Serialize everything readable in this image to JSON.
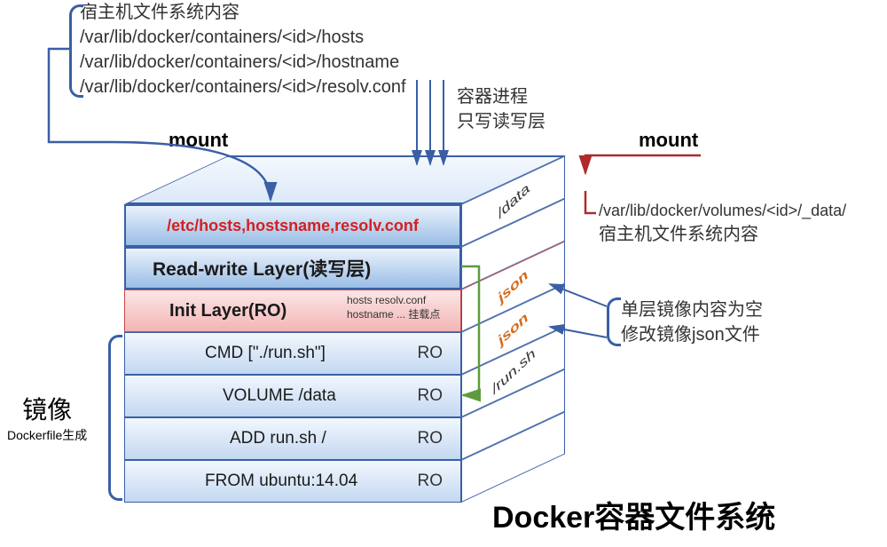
{
  "title": "Docker容器文件系统",
  "hostBlock": {
    "heading": "宿主机文件系统内容",
    "lines": [
      "/var/lib/docker/containers/<id>/hosts",
      "/var/lib/docker/containers/<id>/hostname",
      "/var/lib/docker/containers/<id>/resolv.conf"
    ]
  },
  "mountLeft": "mount",
  "mountRight": "mount",
  "containerProc": {
    "line1": "容器进程",
    "line2": "只写读写层"
  },
  "layers": {
    "rw": {
      "etcText": "/etc/hosts,hostsname,resolv.conf",
      "name": "Read-write Layer(读写层)"
    },
    "init": {
      "name": "Init Layer(RO)",
      "filesTop": "hosts    resolv.conf",
      "filesBottom": "hostname ... 挂载点"
    },
    "cmd": {
      "text": "CMD [\"./run.sh\"]",
      "mode": "RO"
    },
    "volume": {
      "text": "VOLUME /data",
      "mode": "RO"
    },
    "add": {
      "text": "ADD run.sh /",
      "mode": "RO"
    },
    "from": {
      "text": "FROM ubuntu:14.04",
      "mode": "RO"
    }
  },
  "side": {
    "data": "/data",
    "json1": "json",
    "json2": "json",
    "runsh": "/run.sh"
  },
  "imageLabel": {
    "main": "镜像",
    "sub": "Dockerfile生成"
  },
  "volumeMount": {
    "path": "/var/lib/docker/volumes/<id>/_data/",
    "desc": "宿主机文件系统内容"
  },
  "jsonNote": {
    "line1": "单层镜像内容为空",
    "line2": "修改镜像json文件"
  }
}
